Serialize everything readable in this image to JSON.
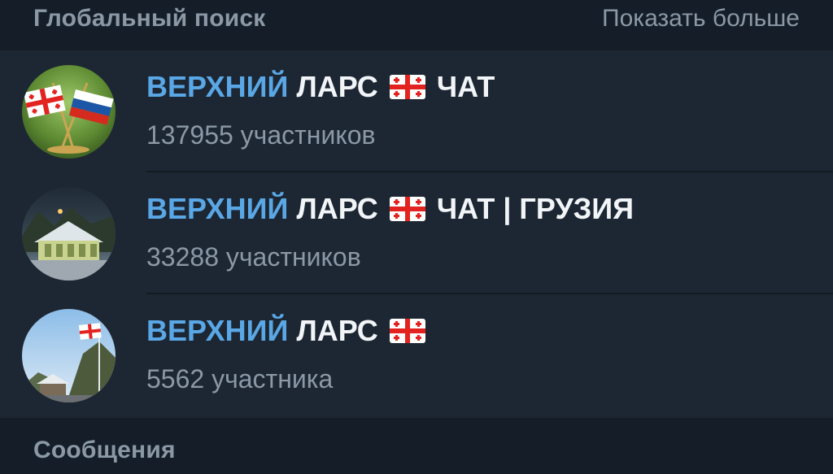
{
  "header": {
    "title": "Глобальный поиск",
    "show_more": "Показать больше"
  },
  "results": [
    {
      "highlight": "ВЕРХНИЙ",
      "title_part1": "ЛАРС",
      "title_part2": "ЧАТ",
      "flag_icon": "georgia-flag-icon",
      "subtitle": "137955 участников"
    },
    {
      "highlight": "ВЕРХНИЙ",
      "title_part1": "ЛАРС",
      "title_part2": "ЧАТ | ГРУЗИЯ",
      "flag_icon": "georgia-flag-icon",
      "subtitle": "33288 участников"
    },
    {
      "highlight": "ВЕРХНИЙ",
      "title_part1": "ЛАРС",
      "title_part2": "",
      "flag_icon": "georgia-flag-icon",
      "subtitle": "5562 участника"
    }
  ],
  "footer": {
    "title": "Сообщения"
  },
  "colors": {
    "highlight": "#5aa7e6",
    "background": "#1d2733",
    "header_bg": "#151e28",
    "secondary_text": "#8b98a6"
  }
}
